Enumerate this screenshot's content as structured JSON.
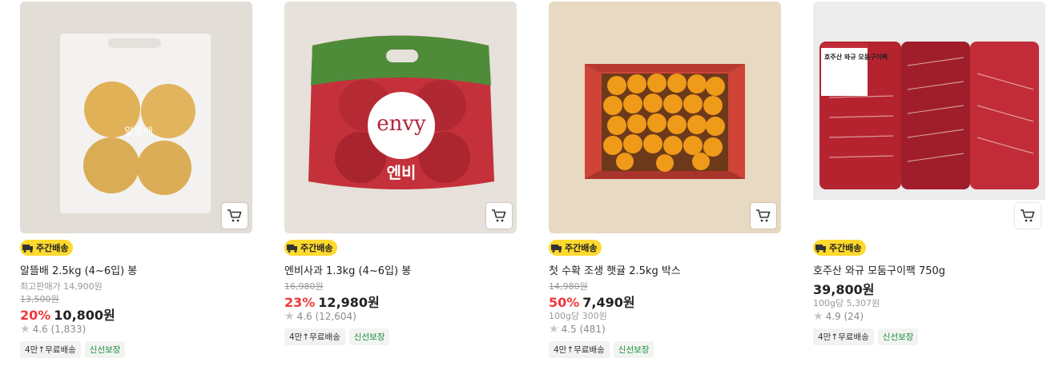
{
  "products": [
    {
      "badge": "주간배송",
      "name": "알뜰배 2.5kg (4~6입) 봉",
      "line1": "최고판매가 14,900원",
      "strike": "13,500원",
      "discount": "20%",
      "price": "10,800원",
      "rating": "4.6",
      "reviews": "(1,833)",
      "tags": [
        "4만↑무료배송",
        "신선보장"
      ],
      "label_on_bag": "알뜰배"
    },
    {
      "badge": "주간배송",
      "name": "엔비사과 1.3kg (4~6입) 봉",
      "strike": "16,980원",
      "discount": "23%",
      "price": "12,980원",
      "rating": "4.6",
      "reviews": "(12,604)",
      "tags": [
        "4만↑무료배송",
        "신선보장"
      ],
      "brand_on_bag": "envy",
      "bag_sub": "엔비"
    },
    {
      "badge": "주간배송",
      "name": "첫 수확 조생 햇귤 2.5kg 박스",
      "strike": "14,980원",
      "discount": "50%",
      "price": "7,490원",
      "unit_price": "100g당 300원",
      "rating": "4.5",
      "reviews": "(481)",
      "tags": [
        "4만↑무료배송",
        "신선보장"
      ]
    },
    {
      "badge": "주간배송",
      "name": "호주산 와규 모둠구이팩 750g",
      "price": "39,800원",
      "unit_price": "100g당 5,307원",
      "rating": "4.9",
      "reviews": "(24)",
      "tags": [
        "4만↑무료배송",
        "신선보장"
      ],
      "pack_label": "호주산 와규 모둠구이팩"
    }
  ],
  "icons": {
    "cart": "cart-icon",
    "truck": "truck-icon",
    "star": "star-icon"
  },
  "colors": {
    "badge": "#ffd92e",
    "discount": "#f0383b",
    "fresh": "#1b8e3e"
  }
}
